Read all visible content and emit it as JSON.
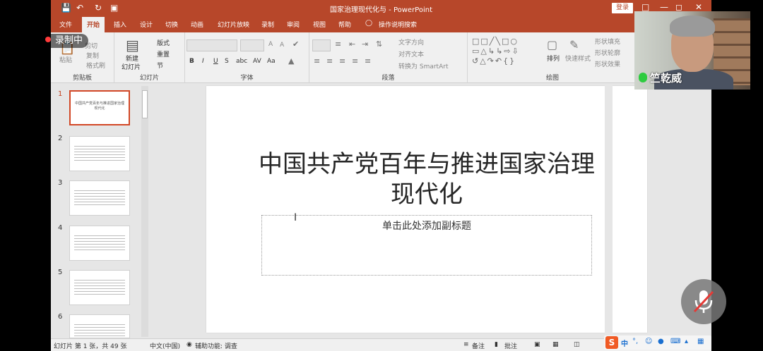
{
  "window": {
    "title": "国家治理现代化与 - PowerPoint",
    "login_label": "登录",
    "quick_access": [
      "save-icon",
      "undo-icon",
      "redo-icon",
      "present-icon"
    ]
  },
  "ribbon_tabs": [
    "文件",
    "开始",
    "插入",
    "设计",
    "切换",
    "动画",
    "幻灯片放映",
    "录制",
    "审阅",
    "视图",
    "帮助",
    "操作说明搜索"
  ],
  "active_tab": "开始",
  "ribbon": {
    "clipboard": {
      "label": "剪贴板",
      "paste": "粘贴",
      "cut": "剪切",
      "copy": "复制",
      "format_painter": "格式刷"
    },
    "slides": {
      "label": "幻灯片",
      "new_slide_1": "新建",
      "new_slide_2": "幻灯片",
      "layout": "版式",
      "reset": "重置",
      "section": "节"
    },
    "font": {
      "label": "字体",
      "bold": "B",
      "italic": "I",
      "underline": "U",
      "shadow": "S",
      "strike": "abc",
      "spacing": "AV",
      "case": "Aa",
      "grow": "A",
      "shrink": "A"
    },
    "paragraph": {
      "label": "段落",
      "text_direction": "文字方向",
      "align_text": "对齐文本",
      "smartart": "转换为 SmartArt"
    },
    "drawing": {
      "label": "绘图",
      "arrange": "排列",
      "quick_styles": "快速样式",
      "shape_fill": "形状填充",
      "shape_outline": "形状轮廓",
      "shape_effects": "形状效果"
    }
  },
  "recording_badge": "录制中",
  "thumbnails": [
    {
      "num": "1",
      "title": "中国共产党百年与推进国家治理现代化"
    },
    {
      "num": "2"
    },
    {
      "num": "3"
    },
    {
      "num": "4"
    },
    {
      "num": "5"
    },
    {
      "num": "6"
    }
  ],
  "slide": {
    "title": "中国共产党百年与推进国家治理现代化",
    "subtitle_placeholder": "单击此处添加副标题"
  },
  "status": {
    "slide_info": "幻灯片 第 1 张，共 49 张",
    "language": "中文(中国)",
    "accessibility": "辅助功能: 调查",
    "notes": "备注",
    "comments": "批注"
  },
  "video": {
    "participant_name": "竺乾威"
  },
  "ime_tray": {
    "logo": "S",
    "mode": "中"
  },
  "colors": {
    "accent": "#b7472a",
    "selected_border": "#d24726"
  }
}
